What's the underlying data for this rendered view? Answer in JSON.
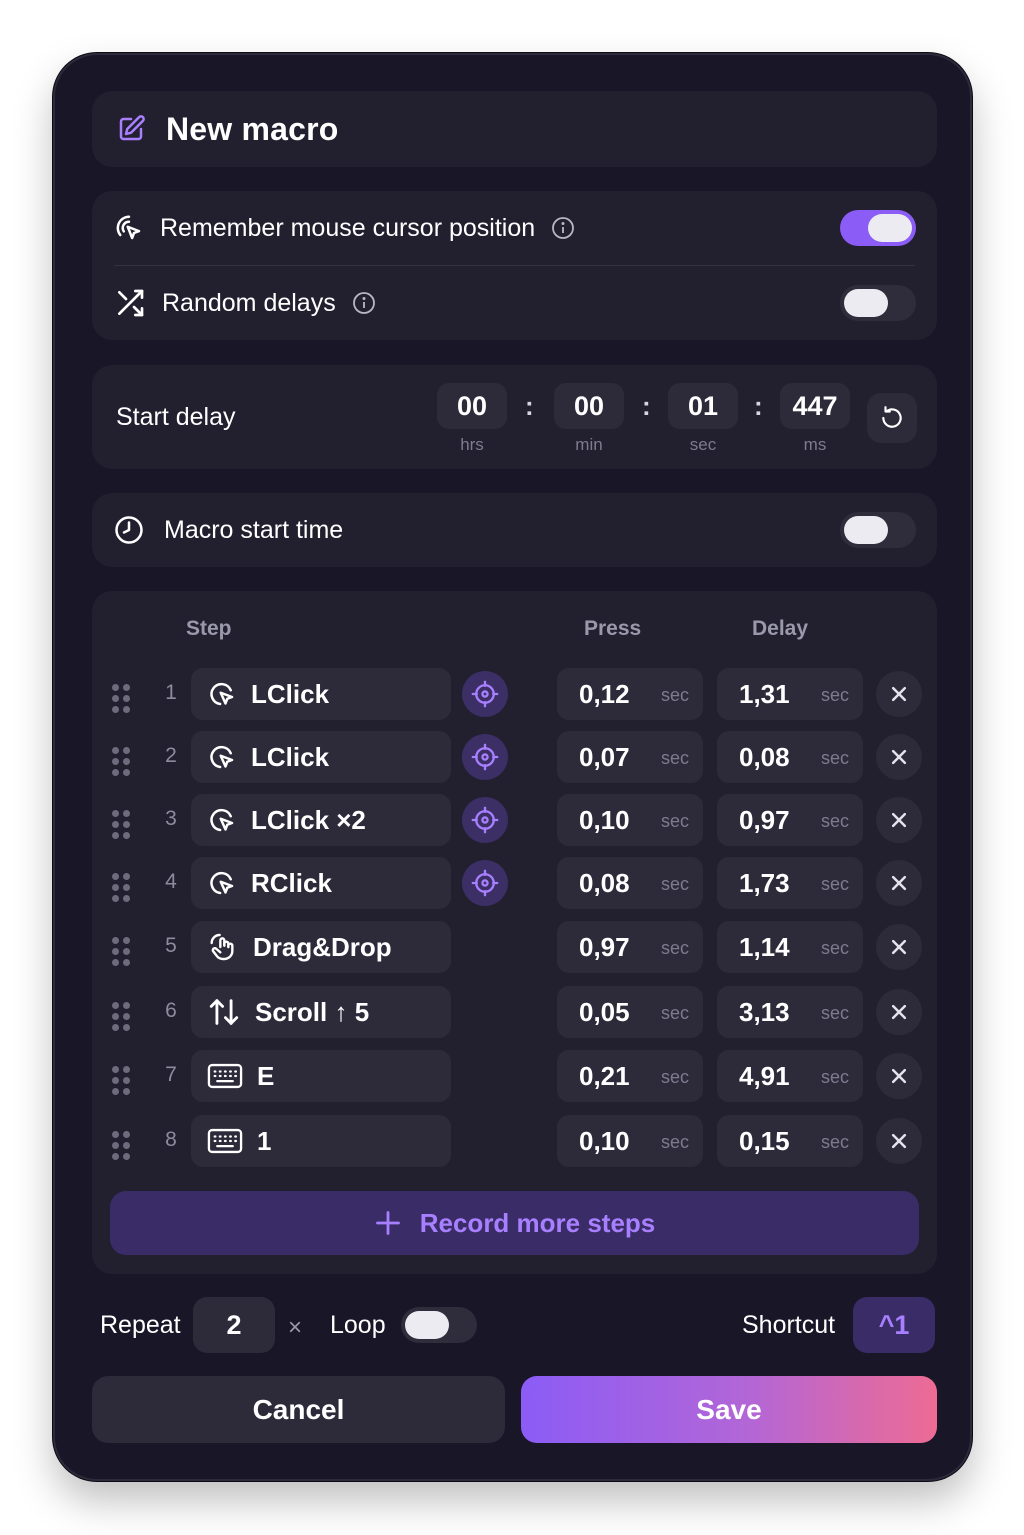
{
  "header": {
    "title": "New macro",
    "icon": "edit-icon"
  },
  "settings": {
    "remember_cursor": {
      "label": "Remember mouse cursor position",
      "enabled": true
    },
    "random_delays": {
      "label": "Random delays",
      "enabled": false
    }
  },
  "start_delay": {
    "label": "Start delay",
    "hours": "00",
    "hours_unit": "hrs",
    "minutes": "00",
    "minutes_unit": "min",
    "seconds": "01",
    "seconds_unit": "sec",
    "ms": "447",
    "ms_unit": "ms",
    "separator": ":"
  },
  "macro_start_time": {
    "label": "Macro start time",
    "enabled": false
  },
  "steps_table": {
    "headers": {
      "step": "Step",
      "press": "Press",
      "delay": "Delay"
    },
    "unit": "sec",
    "steps": [
      {
        "num": "1",
        "action": "LClick",
        "icon": "mouse-click-icon",
        "targetable": true,
        "press": "0,12",
        "delay": "1,31"
      },
      {
        "num": "2",
        "action": "LClick",
        "icon": "mouse-click-icon",
        "targetable": true,
        "press": "0,07",
        "delay": "0,08"
      },
      {
        "num": "3",
        "action": "LClick ×2",
        "icon": "mouse-click-icon",
        "targetable": true,
        "press": "0,10",
        "delay": "0,97"
      },
      {
        "num": "4",
        "action": "RClick",
        "icon": "mouse-click-icon",
        "targetable": true,
        "press": "0,08",
        "delay": "1,73"
      },
      {
        "num": "5",
        "action": "Drag&Drop",
        "icon": "hand-drag-icon",
        "targetable": false,
        "press": "0,97",
        "delay": "1,14"
      },
      {
        "num": "6",
        "action": "Scroll ↑ 5",
        "icon": "scroll-arrows-icon",
        "targetable": false,
        "press": "0,05",
        "delay": "3,13"
      },
      {
        "num": "7",
        "action": "E",
        "icon": "keyboard-icon",
        "targetable": false,
        "press": "0,21",
        "delay": "4,91"
      },
      {
        "num": "8",
        "action": "1",
        "icon": "keyboard-icon",
        "targetable": false,
        "press": "0,10",
        "delay": "0,15"
      }
    ],
    "record_label": "Record more steps"
  },
  "footer": {
    "repeat_label": "Repeat",
    "repeat_value": "2",
    "times_symbol": "×",
    "loop_label": "Loop",
    "loop_enabled": false,
    "shortcut_label": "Shortcut",
    "shortcut_value": "^1"
  },
  "actions": {
    "cancel_label": "Cancel",
    "save_label": "Save"
  },
  "colors": {
    "accent": "#8b5cf6",
    "accent_text": "#a880ff",
    "background": "#181627",
    "card": "#22202f"
  }
}
